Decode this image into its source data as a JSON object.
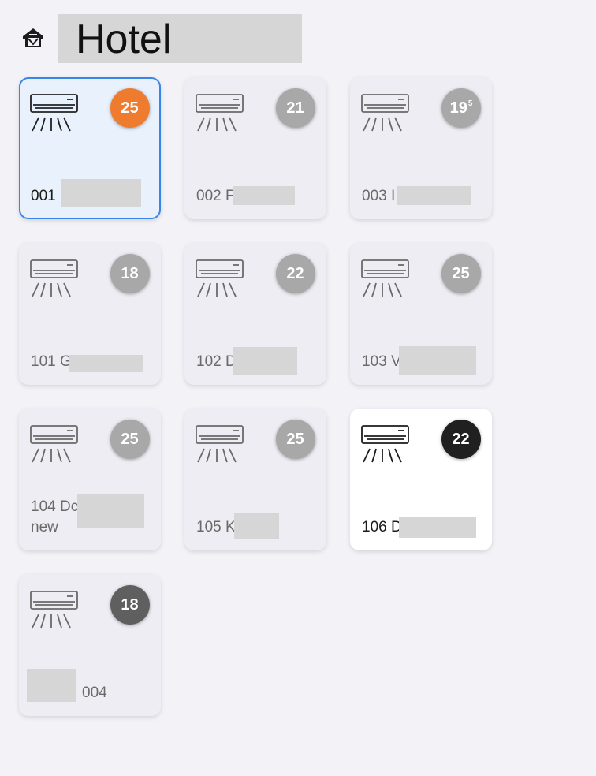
{
  "header": {
    "title": "Hotel",
    "home_icon": "home-icon"
  },
  "rooms": [
    {
      "name": "001",
      "temperature": "25",
      "temp_fraction": "",
      "state": "selected",
      "badge_color": "#ef7b2e",
      "icon": "air-conditioner-icon"
    },
    {
      "name": "002 F",
      "temperature": "21",
      "temp_fraction": "",
      "state": "idle",
      "badge_color": "#a8a8a8",
      "icon": "air-conditioner-icon"
    },
    {
      "name": "003 I",
      "temperature": "19",
      "temp_fraction": "5",
      "state": "idle",
      "badge_color": "#a8a8a8",
      "icon": "air-conditioner-icon"
    },
    {
      "name": "101 G",
      "temperature": "18",
      "temp_fraction": "",
      "state": "idle",
      "badge_color": "#a8a8a8",
      "icon": "air-conditioner-icon"
    },
    {
      "name": "102 D",
      "temperature": "22",
      "temp_fraction": "",
      "state": "idle",
      "badge_color": "#a8a8a8",
      "icon": "air-conditioner-icon"
    },
    {
      "name": "103 V",
      "temperature": "25",
      "temp_fraction": "",
      "state": "idle",
      "badge_color": "#a8a8a8",
      "icon": "air-conditioner-icon"
    },
    {
      "name": "104 Dc\nnew",
      "temperature": "25",
      "temp_fraction": "",
      "state": "idle",
      "badge_color": "#a8a8a8",
      "icon": "air-conditioner-icon"
    },
    {
      "name": "105 K",
      "temperature": "25",
      "temp_fraction": "",
      "state": "idle",
      "badge_color": "#a8a8a8",
      "icon": "air-conditioner-icon"
    },
    {
      "name": "106 D",
      "temperature": "22",
      "temp_fraction": "",
      "state": "on",
      "badge_color": "#202020",
      "icon": "air-conditioner-icon"
    },
    {
      "name": "004",
      "temperature": "18",
      "temp_fraction": "",
      "state": "idle",
      "badge_color": "#5f5f5f",
      "icon": "air-conditioner-icon"
    }
  ]
}
